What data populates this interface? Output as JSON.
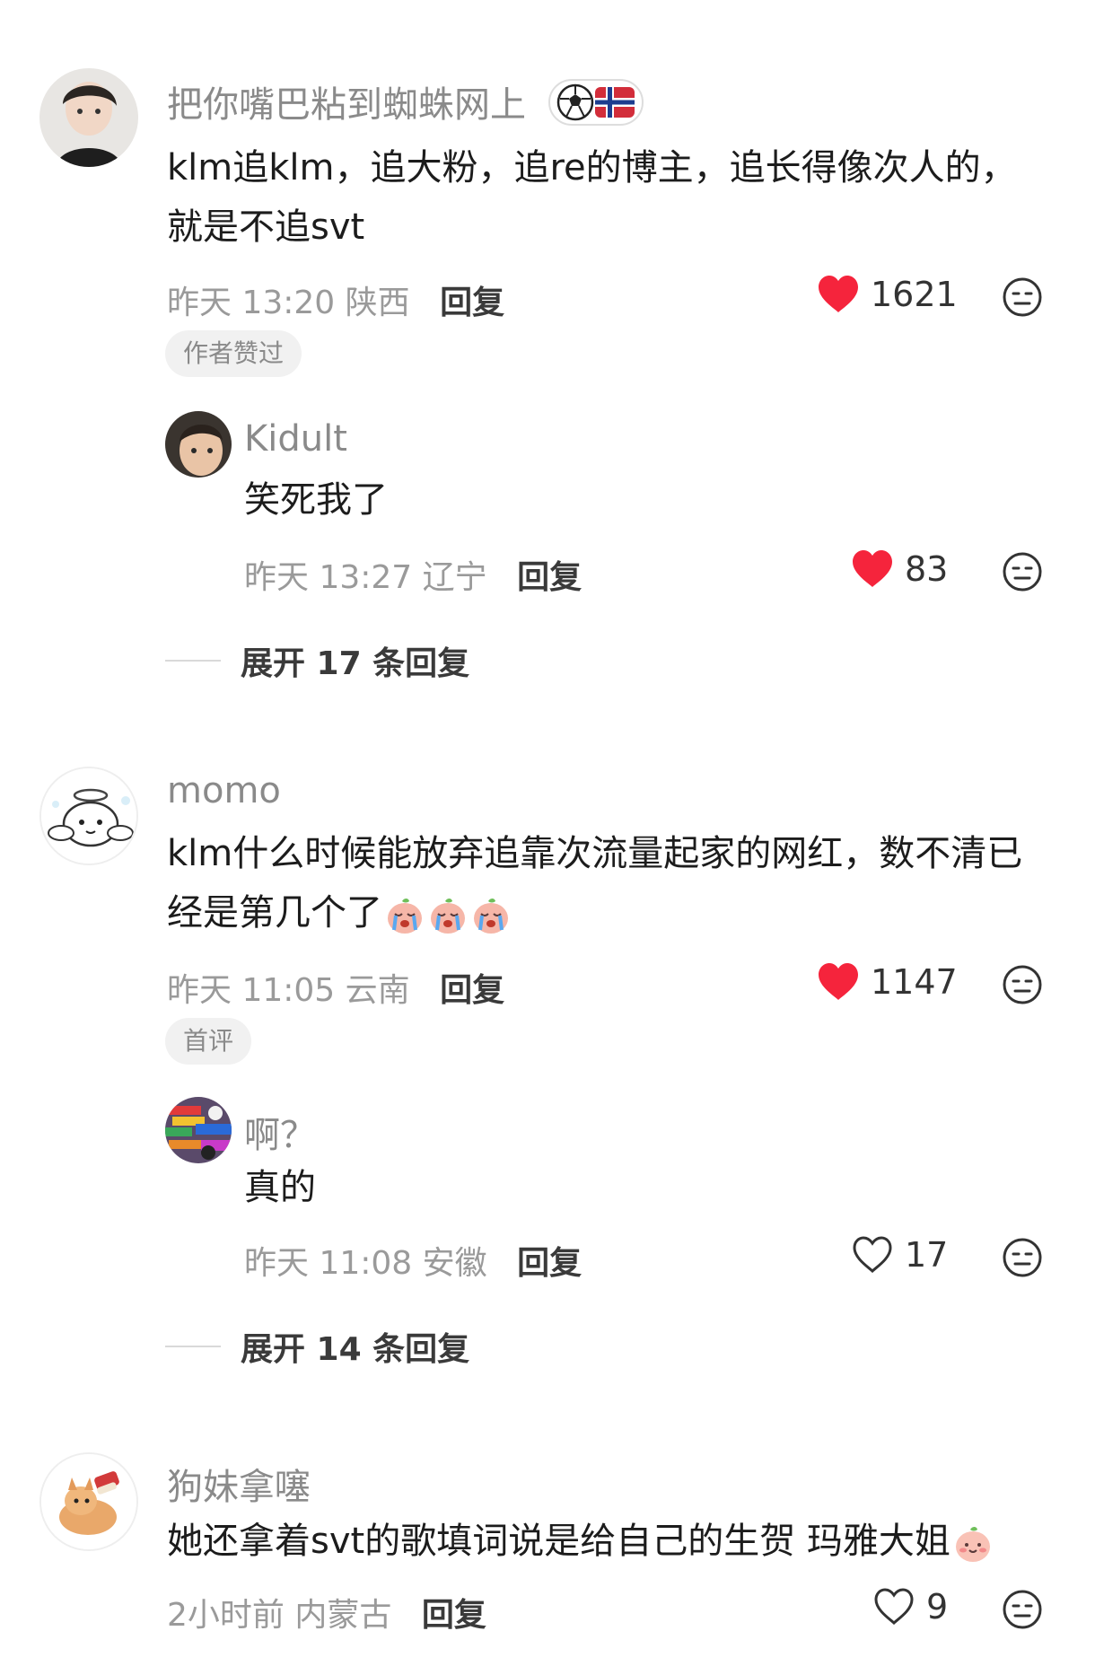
{
  "comments": [
    {
      "username": "把你嘴巴粘到蜘蛛网上",
      "text_line1": "klm追klm，追大粉，追re的博主，追长得像次人的，",
      "text_line2": "就是不追svt",
      "time": "昨天 13:20 陕西",
      "reply_label": "回复",
      "likes": "1621",
      "liked": true,
      "tag": "作者赞过",
      "reply": {
        "username": "Kidult",
        "text": "笑死我了",
        "time": "昨天 13:27 辽宁",
        "reply_label": "回复",
        "likes": "83",
        "liked": true
      },
      "expand_label": "展开 17 条回复"
    },
    {
      "username": "momo",
      "text_line1": "klm什么时候能放弃追靠次流量起家的网红，数不清已",
      "text_line2": "经是第几个了",
      "emoji_icons": [
        "crying-peach-icon",
        "crying-peach-icon",
        "crying-peach-icon"
      ],
      "time": "昨天 11:05 云南",
      "reply_label": "回复",
      "likes": "1147",
      "liked": true,
      "tag": "首评",
      "reply": {
        "username": "啊？",
        "text": "真的",
        "time": "昨天 11:08 安徽",
        "reply_label": "回复",
        "likes": "17",
        "liked": false
      },
      "expand_label": "展开 14 条回复"
    },
    {
      "username": "狗妹拿噻",
      "text_line1": "她还拿着svt的歌填词说是给自己的生贺 玛雅大姐",
      "emoji_icons": [
        "smiling-peach-icon"
      ],
      "time": "2小时前 内蒙古",
      "reply_label": "回复",
      "likes": "9",
      "liked": false
    }
  ],
  "colors": {
    "like_red": "#f5243c",
    "muted_text": "#9a9a9a",
    "tag_bg": "#f1f1f1"
  }
}
